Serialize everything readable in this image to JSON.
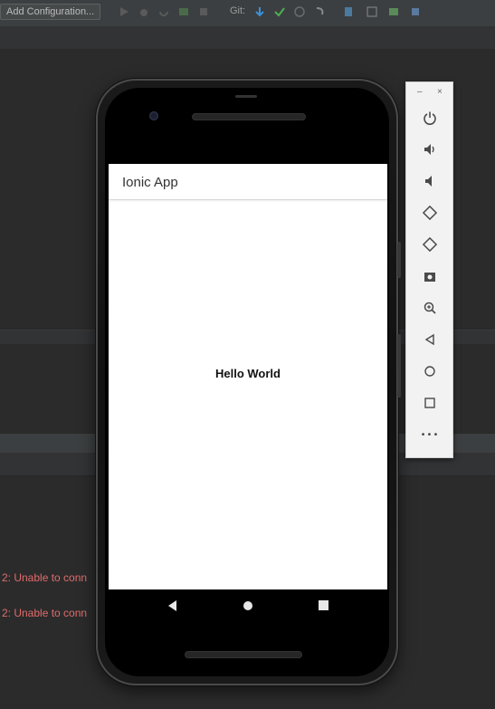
{
  "ide": {
    "config_label": "Add Configuration...",
    "git_label": "Git:",
    "log_lines": [
      "2: Unable to conn",
      "2: Unable to conn"
    ]
  },
  "app": {
    "toolbar_title": "Ionic App",
    "content_text": "Hello World"
  },
  "emulator_toolbar": {
    "minimize": "–",
    "close": "×",
    "more": "•••",
    "buttons": [
      "power-icon",
      "volume-up-icon",
      "volume-down-icon",
      "rotate-left-icon",
      "rotate-right-icon",
      "camera-icon",
      "zoom-icon",
      "back-icon",
      "home-icon",
      "overview-icon",
      "more-icon"
    ]
  },
  "colors": {
    "ide_bg": "#2b2b2b",
    "error_text": "#e06c6c",
    "phone_body": "#111111",
    "screen_bg": "#ffffff",
    "emulator_panel": "#f2f2f2"
  }
}
